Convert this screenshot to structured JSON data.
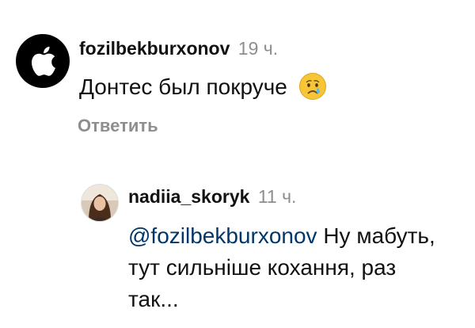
{
  "comment": {
    "avatar_icon": "apple-logo-icon",
    "username": "fozilbekburxonov",
    "time": "19 ч.",
    "text": "Донтес был покруче",
    "emoji": "crying-face-emoji",
    "reply_label": "Ответить"
  },
  "reply": {
    "avatar_icon": "profile-photo",
    "username": "nadiia_skoryk",
    "time": "11 ч.",
    "mention": "@fozilbekburxonov",
    "text": " Ну мабуть, тут сильніше кохання, раз так..."
  },
  "colors": {
    "text": "#111111",
    "muted": "#8e8e8e",
    "mention": "#00376b"
  }
}
